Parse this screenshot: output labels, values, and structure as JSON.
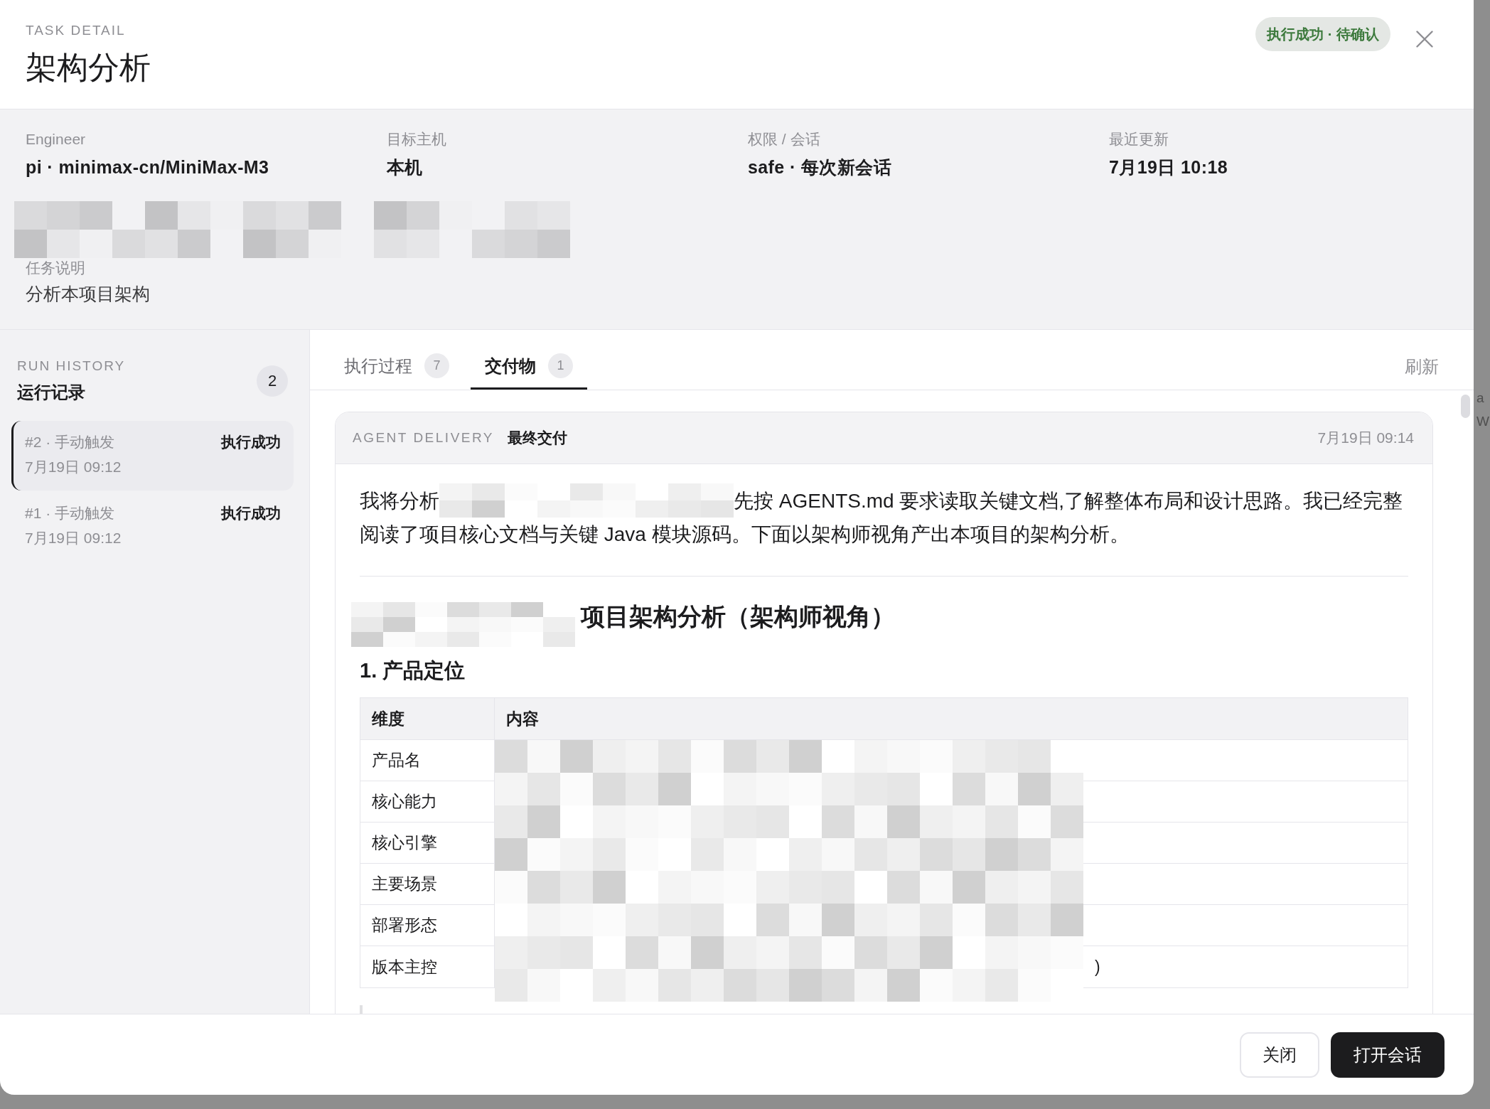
{
  "header": {
    "eyebrow": "TASK DETAIL",
    "title": "架构分析",
    "status_badge": "执行成功 · 待确认"
  },
  "summary": {
    "fields": [
      {
        "label": "Engineer",
        "value": "pi · minimax-cn/MiniMax-M3"
      },
      {
        "label": "目标主机",
        "value": "本机"
      },
      {
        "label": "权限 / 会话",
        "value": "safe · 每次新会话"
      },
      {
        "label": "最近更新",
        "value": "7月19日 10:18"
      }
    ],
    "description": {
      "label": "任务说明",
      "value": "分析本项目架构"
    }
  },
  "run_history": {
    "eyebrow": "RUN HISTORY",
    "title": "运行记录",
    "count": "2",
    "runs": [
      {
        "title": "#2 · 手动触发",
        "time": "7月19日 09:12",
        "status": "执行成功",
        "selected": true
      },
      {
        "title": "#1 · 手动触发",
        "time": "7月19日 09:12",
        "status": "执行成功",
        "selected": false
      }
    ]
  },
  "tabs": [
    {
      "label": "执行过程",
      "count": "7",
      "selected": false
    },
    {
      "label": "交付物",
      "count": "1",
      "selected": true
    }
  ],
  "refresh": "刷新",
  "delivery": {
    "eyebrow": "AGENT DELIVERY",
    "title": "最终交付",
    "time": "7月19日 09:14",
    "intro": {
      "before_redaction": "我将分析",
      "after_redaction_line_1": "先按 AGENTS.md 要求读取关键文档,了解整体布局和设计思路。我已经完整",
      "after_redaction_line_2": "阅读了项目核心文档与关键 Java 模块源码。下面以架构师视角产出本项目的架构分析。"
    },
    "heading": "项目架构分析（架构师视角）",
    "section_title": "1. 产品定位",
    "table": {
      "columns": [
        "维度",
        "内容"
      ],
      "rows": [
        {
          "dimension": "产品名"
        },
        {
          "dimension": "核心能力"
        },
        {
          "dimension": "核心引擎"
        },
        {
          "dimension": "主要场景"
        },
        {
          "dimension": "部署形态"
        },
        {
          "dimension": "版本主控",
          "content": ")"
        }
      ]
    }
  },
  "footer": {
    "buttons": [
      {
        "label": "关闭",
        "kind": "secondary"
      },
      {
        "label": "打开会话",
        "kind": "primary"
      }
    ]
  },
  "backdrop_fragments": [
    "a",
    "W"
  ]
}
